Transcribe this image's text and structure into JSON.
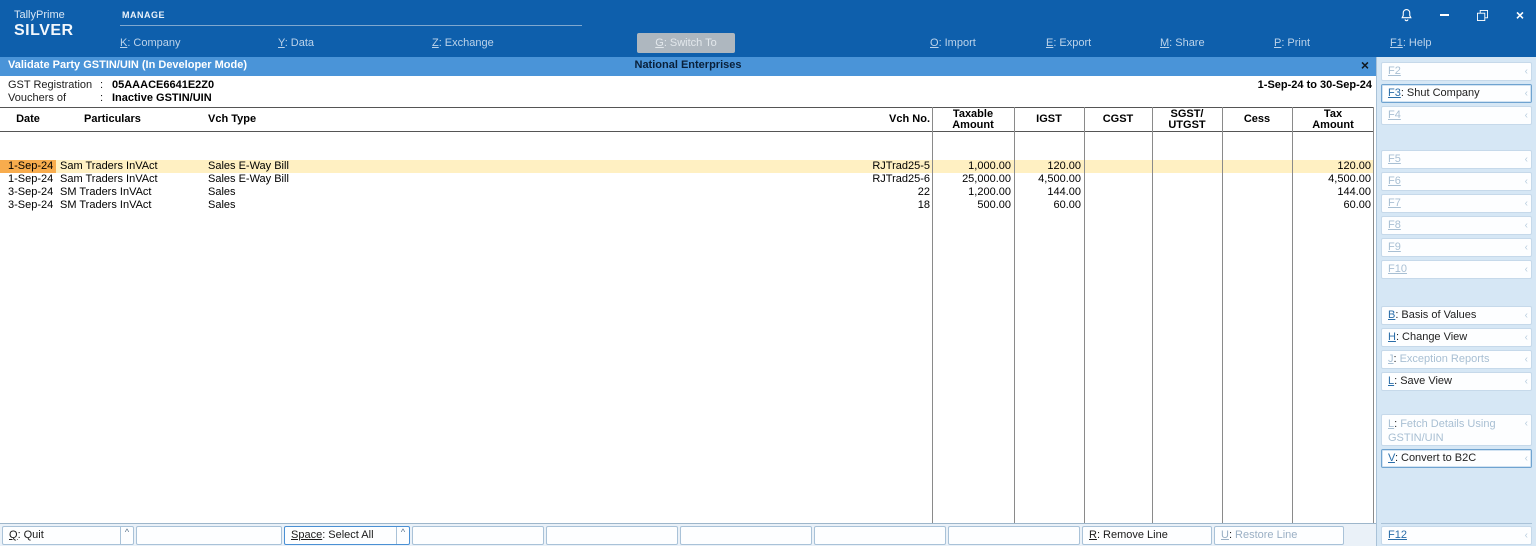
{
  "ui": {
    "key_separator": ":"
  },
  "colors": {
    "topbar_blue": "#0E5FAC",
    "titlebar_blue": "#4A94D8",
    "sidebar_bg": "#D6E7F5",
    "selected_row_bg": "#FFF0C2",
    "selected_date_cell_bg": "#F8AC4D"
  },
  "icons": {
    "expand_arrow": "‹",
    "caret_up": "^",
    "close": "×",
    "minimize": "–"
  },
  "topbar": {
    "brand_line1": "TallyPrime",
    "brand_line2": "SILVER",
    "group_label": "MANAGE",
    "company": {
      "key": "K",
      "label": "Company"
    },
    "data": {
      "key": "Y",
      "label": "Data"
    },
    "exchange": {
      "key": "Z",
      "label": "Exchange"
    },
    "switch_to": {
      "key": "G",
      "label": "Switch To"
    },
    "import": {
      "key": "O",
      "label": "Import"
    },
    "export": {
      "key": "E",
      "label": "Export"
    },
    "share": {
      "key": "M",
      "label": "Share"
    },
    "print": {
      "key": "P",
      "label": "Print"
    },
    "help": {
      "key": "F1",
      "label": "Help"
    }
  },
  "titlebar": {
    "title": "Validate Party GSTIN/UIN (In Developer Mode)",
    "company_name": "National Enterprises"
  },
  "report_header": {
    "gst_registration_label": "GST Registration",
    "gst_registration_value": "05AAACE6641E2Z0",
    "vouchers_of_label": "Vouchers of",
    "vouchers_of_value": "Inactive GSTIN/UIN",
    "period": "1-Sep-24 to 30-Sep-24"
  },
  "table": {
    "headers": {
      "date": "Date",
      "particulars": "Particulars",
      "vch_type": "Vch Type",
      "vch_no": "Vch No.",
      "taxable": "Taxable\nAmount",
      "igst": "IGST",
      "cgst": "CGST",
      "sgst": "SGST/\nUTGST",
      "cess": "Cess",
      "tax": "Tax\nAmount"
    },
    "rows": [
      {
        "date": "1-Sep-24",
        "particulars": "Sam Traders InVAct",
        "vch_type": "Sales E-Way Bill",
        "vch_no": "RJTrad25-5",
        "taxable": "1,000.00",
        "igst": "120.00",
        "cgst": "",
        "sgst": "",
        "cess": "",
        "tax": "120.00"
      },
      {
        "date": "1-Sep-24",
        "particulars": "Sam Traders InVAct",
        "vch_type": "Sales E-Way Bill",
        "vch_no": "RJTrad25-6",
        "taxable": "25,000.00",
        "igst": "4,500.00",
        "cgst": "",
        "sgst": "",
        "cess": "",
        "tax": "4,500.00"
      },
      {
        "date": "3-Sep-24",
        "particulars": "SM Traders InVAct",
        "vch_type": "Sales",
        "vch_no": "22",
        "taxable": "1,200.00",
        "igst": "144.00",
        "cgst": "",
        "sgst": "",
        "cess": "",
        "tax": "144.00"
      },
      {
        "date": "3-Sep-24",
        "particulars": "SM Traders InVAct",
        "vch_type": "Sales",
        "vch_no": "18",
        "taxable": "500.00",
        "igst": "60.00",
        "cgst": "",
        "sgst": "",
        "cess": "",
        "tax": "60.00"
      }
    ]
  },
  "sidebar": {
    "f2": {
      "key": "F2",
      "label": ""
    },
    "f3": {
      "key": "F3",
      "label": "Shut Company"
    },
    "f4": {
      "key": "F4",
      "label": ""
    },
    "f5": {
      "key": "F5",
      "label": ""
    },
    "f6": {
      "key": "F6",
      "label": ""
    },
    "f7": {
      "key": "F7",
      "label": ""
    },
    "f8": {
      "key": "F8",
      "label": ""
    },
    "f9": {
      "key": "F9",
      "label": ""
    },
    "f10": {
      "key": "F10",
      "label": ""
    },
    "basis_of_values": {
      "key": "B",
      "label": "Basis of Values"
    },
    "change_view": {
      "key": "H",
      "label": "Change View"
    },
    "exception_reports": {
      "key": "J",
      "label": "Exception Reports"
    },
    "save_view": {
      "key": "L",
      "label": "Save View"
    },
    "fetch_details": {
      "key": "L",
      "label": "Fetch Details Using GSTIN/UIN"
    },
    "convert_b2c": {
      "key": "V",
      "label": "Convert to B2C"
    },
    "f12": {
      "key": "F12",
      "label": ""
    }
  },
  "bottombar": {
    "quit": {
      "key": "Q",
      "label": "Quit"
    },
    "select_all": {
      "key": "Space",
      "label": "Select All"
    },
    "remove_line": {
      "key": "R",
      "label": "Remove Line"
    },
    "restore_line": {
      "key": "U",
      "label": "Restore Line"
    }
  }
}
